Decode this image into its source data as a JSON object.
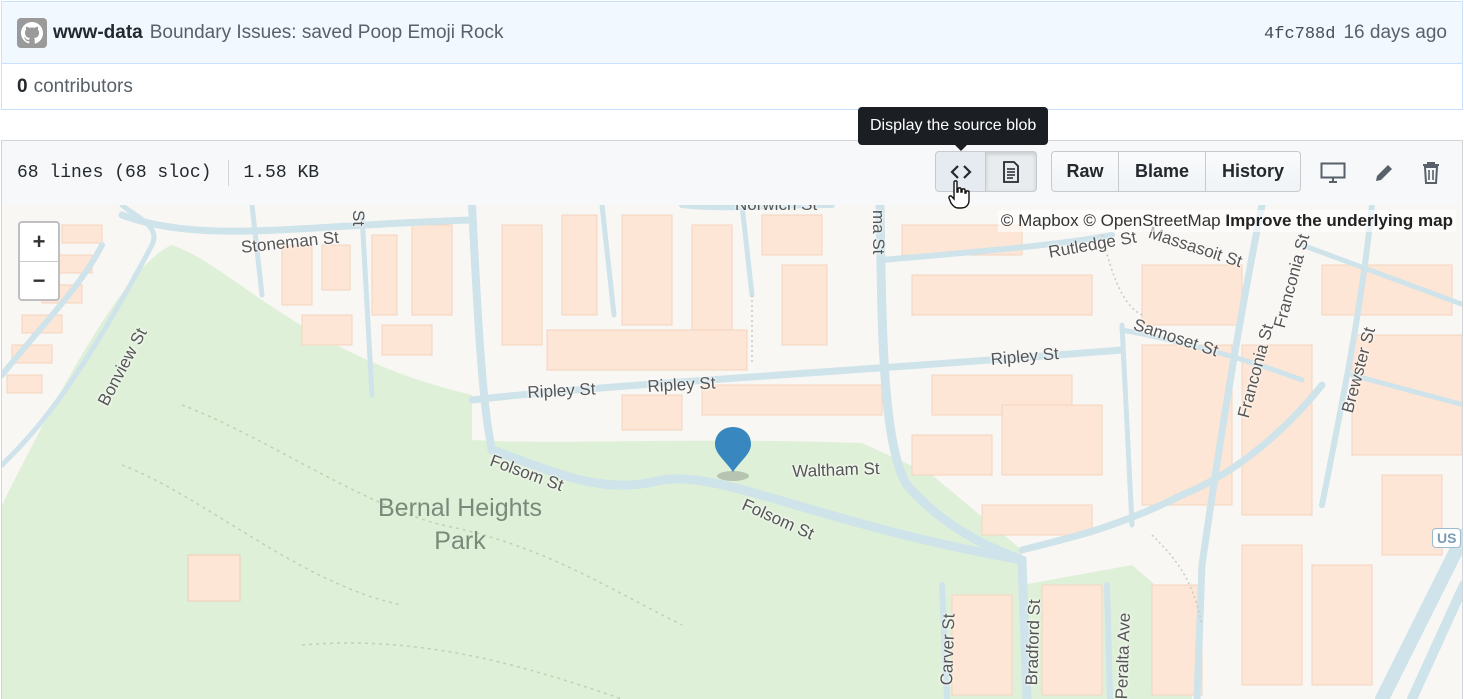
{
  "commit": {
    "author": "www-data",
    "message": "Boundary Issues: saved Poop Emoji Rock",
    "sha": "4fc788d",
    "age": "16 days ago"
  },
  "contributors": {
    "count": "0",
    "label": "contributors"
  },
  "file_header": {
    "lines": "68 lines (68 sloc)",
    "size": "1.58 KB",
    "tooltip": "Display the source blob",
    "buttons": {
      "raw": "Raw",
      "blame": "Blame",
      "history": "History"
    },
    "icons": {
      "source": "code-icon",
      "rendered": "file-text-icon",
      "desktop": "desktop-icon",
      "edit": "pencil-icon",
      "delete": "trash-icon"
    }
  },
  "map": {
    "zoom_in": "+",
    "zoom_out": "−",
    "attribution_prefix": "© Mapbox © OpenStreetMap",
    "attribution_link": "Improve the underlying map",
    "park": "Bernal Heights Park",
    "highway_shield": "US",
    "streets": [
      "Norwich St",
      "Stoneman St",
      "St",
      "ma St",
      "Rutledge St",
      "Massasoit St",
      "Franconia St",
      "Franconia St",
      "Bonview St",
      "Samoset St",
      "Brewster St",
      "Ripley St",
      "Ripley St",
      "Ripley St",
      "Folsom St",
      "Folsom St",
      "Waltham St",
      "Carver St",
      "Bradford St",
      "Peralta Ave"
    ]
  },
  "colors": {
    "commit_bg": "#f1f8ff",
    "tooltip_bg": "#1b1f23",
    "park": "#dff0d8",
    "road": "#cfe3ea",
    "building": "#fde6d5",
    "marker": "#3887be"
  }
}
